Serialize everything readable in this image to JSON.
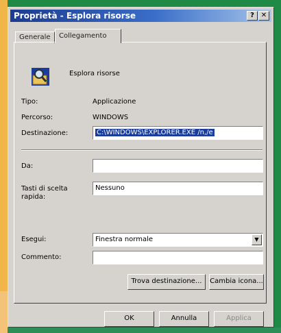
{
  "window": {
    "title": "Proprietà - Esplora risorse",
    "help_glyph": "?",
    "close_glyph": "✕"
  },
  "tabs": [
    {
      "label": "Generale",
      "active": false
    },
    {
      "label": "Collegamento",
      "active": true
    }
  ],
  "shortcut": {
    "name": "Esplora risorse",
    "icon": "magnifier-folder-icon",
    "tipo_label": "Tipo:",
    "tipo_value": "Applicazione",
    "percorso_label": "Percorso:",
    "percorso_value": "WINDOWS",
    "destinazione_label": "Destinazione:",
    "destinazione_value": "C:\\WINDOWS\\EXPLORER.EXE /n,/e",
    "da_label": "Da:",
    "da_value": "",
    "tasti_label_1": "Tasti di scelta",
    "tasti_label_2": "rapida:",
    "tasti_value": "Nessuno",
    "esegui_label": "Esegui:",
    "esegui_value": "Finestra normale",
    "commento_label": "Commento:",
    "commento_value": ""
  },
  "buttons": {
    "trova": "Trova destinazione...",
    "cambia": "Cambia icona...",
    "ok": "OK",
    "annulla": "Annulla",
    "applica": "Applica"
  },
  "colors": {
    "title_start": "#1c3b92",
    "title_end": "#a6c4ea",
    "dialog_bg": "#d6d3ce",
    "selection": "#1a3c9c"
  }
}
